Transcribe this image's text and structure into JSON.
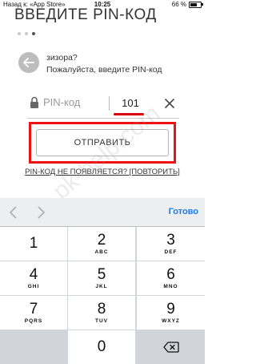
{
  "status_bar": {
    "back_to_app": "Назад к: «App Store»",
    "time": "10:25",
    "battery_percent": "66 %",
    "battery_level": 0.66
  },
  "heading": "ВВЕДИТЕ PIN-КОД",
  "pager": {
    "count": 3,
    "active_index": 2
  },
  "help": {
    "back_icon": "back-arrow-icon",
    "line1": "зизора?",
    "line2": "Пожалуйста, введите PIN-код"
  },
  "pin_field": {
    "label": "PIN-код",
    "value": "101",
    "lock_icon": "lock-icon",
    "clear_icon": "close-icon",
    "accent_color": "#dd0000"
  },
  "send_button": {
    "label": "ОТПРАВИТЬ",
    "highlight_color": "#ee1111"
  },
  "resend_link": "PIN-КОД НЕ ПОЯВЛЯЕТСЯ? [ПОВТОРИТЬ]",
  "watermark": "pk-help.com",
  "keyboard": {
    "done_label": "Готово",
    "done_color": "#1a7cf0",
    "keys": [
      {
        "digit": "1",
        "letters": ""
      },
      {
        "digit": "2",
        "letters": "ABC"
      },
      {
        "digit": "3",
        "letters": "DEF"
      },
      {
        "digit": "4",
        "letters": "GHI"
      },
      {
        "digit": "5",
        "letters": "JKL"
      },
      {
        "digit": "6",
        "letters": "MNO"
      },
      {
        "digit": "7",
        "letters": "PQRS"
      },
      {
        "digit": "8",
        "letters": "TUV"
      },
      {
        "digit": "9",
        "letters": "WXYZ"
      },
      {
        "digit": "0",
        "letters": ""
      }
    ]
  }
}
